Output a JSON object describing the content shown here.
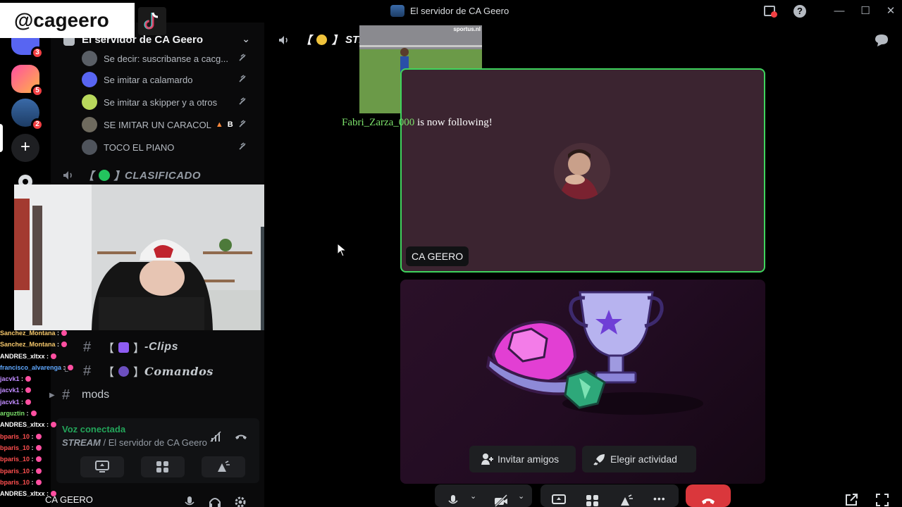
{
  "window": {
    "title": "El servidor de CA Geero"
  },
  "overlay": {
    "handle": "@cageero"
  },
  "rail": {
    "badges": [
      "3",
      "5",
      "2"
    ]
  },
  "sidebar": {
    "server_name": "El servidor de CA Geero",
    "voice_users": [
      {
        "name": "Se decir: suscribanse a cacg..."
      },
      {
        "name": "Se imitar a calamardo"
      },
      {
        "name": "Se imitar a skipper y a otros"
      },
      {
        "name": "SE IMITAR UN CARACOL",
        "badge": "B"
      },
      {
        "name": "TOCO EL PIANO"
      }
    ],
    "voice_channel": "CLASIFICADO",
    "voice_channel_brackets": [
      "【",
      "】"
    ],
    "text_channels": [
      {
        "name": "-Clips"
      },
      {
        "name": "Comandos"
      },
      {
        "name": "mods"
      }
    ]
  },
  "voice_panel": {
    "status": "Voz conectada",
    "channel": "STREAM",
    "separator": " / ",
    "server": "El servidor de CA Geero"
  },
  "user_area": {
    "username": "CA GEERO"
  },
  "chat": [
    {
      "user": "Sanchez_Montana",
      "color": "#f5c76b"
    },
    {
      "user": "Sanchez_Montana",
      "color": "#f5c76b"
    },
    {
      "user": "ANDRES_xltxx",
      "color": "#ffffff"
    },
    {
      "user": "francisco_alvarenga",
      "color": "#5fa8ff"
    },
    {
      "user": "jacvk1",
      "color": "#c08bff"
    },
    {
      "user": "jacvk1",
      "color": "#c08bff"
    },
    {
      "user": "jacvk1",
      "color": "#c08bff"
    },
    {
      "user": "arguztin",
      "color": "#7be06a"
    },
    {
      "user": "ANDRES_xltxx",
      "color": "#ffffff"
    },
    {
      "user": "bparis_10",
      "color": "#ff4f4f"
    },
    {
      "user": "bparis_10",
      "color": "#ff4f4f"
    },
    {
      "user": "bparis_10",
      "color": "#ff4f4f"
    },
    {
      "user": "bparis_10",
      "color": "#ff4f4f"
    },
    {
      "user": "bparis_10",
      "color": "#ff4f4f"
    },
    {
      "user": "ANDRES_xltxx",
      "color": "#ffffff"
    }
  ],
  "chat_separator": " :",
  "stage": {
    "channel_name": "STREAM",
    "follow_user": "Fabri_Zarza_000",
    "follow_text": " is now following!",
    "clip_watermark": "sportus.nl",
    "participant_name": "CA GEERO",
    "invite_label": "Invitar amigos",
    "choose_activity_label": "Elegir actividad"
  },
  "colors": {
    "speaking_border": "#3fd45d",
    "end_call": "#da373c",
    "connected_green": "#23a55a",
    "notification_red": "#f23f43"
  }
}
